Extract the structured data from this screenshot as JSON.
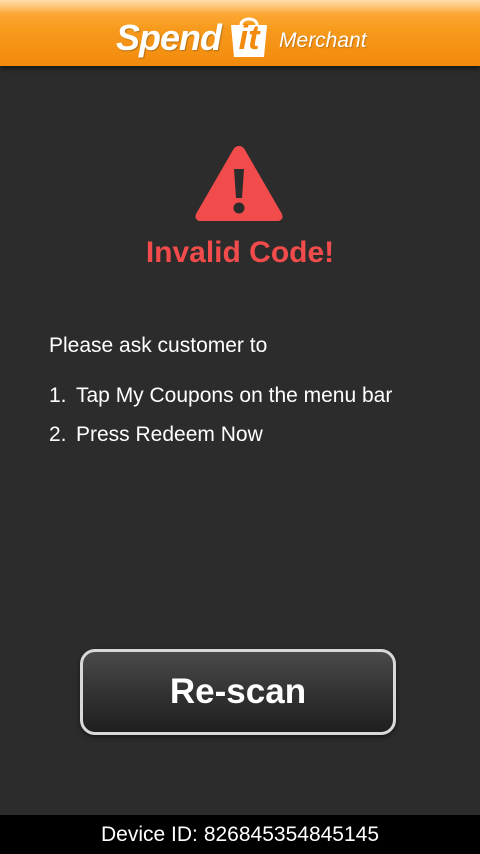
{
  "header": {
    "logo": {
      "brand_word": "Spend",
      "bag_word": "it",
      "subtitle": "Merchant"
    }
  },
  "alert": {
    "icon": "warning-triangle-icon",
    "title": "Invalid Code!",
    "intro": "Please ask customer to",
    "steps": [
      {
        "number": "1.",
        "text": "Tap My Coupons on the menu bar"
      },
      {
        "number": "2.",
        "text": "Press Redeem Now"
      }
    ]
  },
  "actions": {
    "rescan_label": "Re-scan"
  },
  "footer": {
    "device_label": "Device ID:",
    "device_id": "826845354845145"
  },
  "colors": {
    "header_orange": "#f79a1c",
    "background": "#2c2c2c",
    "error_red": "#f24b4b",
    "footer_black": "#000000"
  }
}
